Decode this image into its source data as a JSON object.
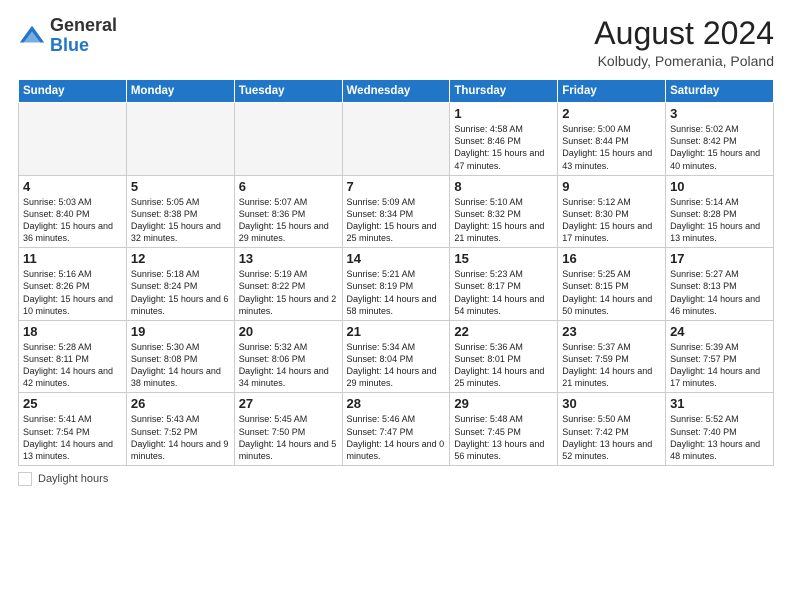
{
  "header": {
    "logo_general": "General",
    "logo_blue": "Blue",
    "month_year": "August 2024",
    "location": "Kolbudy, Pomerania, Poland"
  },
  "days_of_week": [
    "Sunday",
    "Monday",
    "Tuesday",
    "Wednesday",
    "Thursday",
    "Friday",
    "Saturday"
  ],
  "weeks": [
    [
      {
        "num": "",
        "content": ""
      },
      {
        "num": "",
        "content": ""
      },
      {
        "num": "",
        "content": ""
      },
      {
        "num": "",
        "content": ""
      },
      {
        "num": "1",
        "content": "Sunrise: 4:58 AM\nSunset: 8:46 PM\nDaylight: 15 hours\nand 47 minutes."
      },
      {
        "num": "2",
        "content": "Sunrise: 5:00 AM\nSunset: 8:44 PM\nDaylight: 15 hours\nand 43 minutes."
      },
      {
        "num": "3",
        "content": "Sunrise: 5:02 AM\nSunset: 8:42 PM\nDaylight: 15 hours\nand 40 minutes."
      }
    ],
    [
      {
        "num": "4",
        "content": "Sunrise: 5:03 AM\nSunset: 8:40 PM\nDaylight: 15 hours\nand 36 minutes."
      },
      {
        "num": "5",
        "content": "Sunrise: 5:05 AM\nSunset: 8:38 PM\nDaylight: 15 hours\nand 32 minutes."
      },
      {
        "num": "6",
        "content": "Sunrise: 5:07 AM\nSunset: 8:36 PM\nDaylight: 15 hours\nand 29 minutes."
      },
      {
        "num": "7",
        "content": "Sunrise: 5:09 AM\nSunset: 8:34 PM\nDaylight: 15 hours\nand 25 minutes."
      },
      {
        "num": "8",
        "content": "Sunrise: 5:10 AM\nSunset: 8:32 PM\nDaylight: 15 hours\nand 21 minutes."
      },
      {
        "num": "9",
        "content": "Sunrise: 5:12 AM\nSunset: 8:30 PM\nDaylight: 15 hours\nand 17 minutes."
      },
      {
        "num": "10",
        "content": "Sunrise: 5:14 AM\nSunset: 8:28 PM\nDaylight: 15 hours\nand 13 minutes."
      }
    ],
    [
      {
        "num": "11",
        "content": "Sunrise: 5:16 AM\nSunset: 8:26 PM\nDaylight: 15 hours\nand 10 minutes."
      },
      {
        "num": "12",
        "content": "Sunrise: 5:18 AM\nSunset: 8:24 PM\nDaylight: 15 hours\nand 6 minutes."
      },
      {
        "num": "13",
        "content": "Sunrise: 5:19 AM\nSunset: 8:22 PM\nDaylight: 15 hours\nand 2 minutes."
      },
      {
        "num": "14",
        "content": "Sunrise: 5:21 AM\nSunset: 8:19 PM\nDaylight: 14 hours\nand 58 minutes."
      },
      {
        "num": "15",
        "content": "Sunrise: 5:23 AM\nSunset: 8:17 PM\nDaylight: 14 hours\nand 54 minutes."
      },
      {
        "num": "16",
        "content": "Sunrise: 5:25 AM\nSunset: 8:15 PM\nDaylight: 14 hours\nand 50 minutes."
      },
      {
        "num": "17",
        "content": "Sunrise: 5:27 AM\nSunset: 8:13 PM\nDaylight: 14 hours\nand 46 minutes."
      }
    ],
    [
      {
        "num": "18",
        "content": "Sunrise: 5:28 AM\nSunset: 8:11 PM\nDaylight: 14 hours\nand 42 minutes."
      },
      {
        "num": "19",
        "content": "Sunrise: 5:30 AM\nSunset: 8:08 PM\nDaylight: 14 hours\nand 38 minutes."
      },
      {
        "num": "20",
        "content": "Sunrise: 5:32 AM\nSunset: 8:06 PM\nDaylight: 14 hours\nand 34 minutes."
      },
      {
        "num": "21",
        "content": "Sunrise: 5:34 AM\nSunset: 8:04 PM\nDaylight: 14 hours\nand 29 minutes."
      },
      {
        "num": "22",
        "content": "Sunrise: 5:36 AM\nSunset: 8:01 PM\nDaylight: 14 hours\nand 25 minutes."
      },
      {
        "num": "23",
        "content": "Sunrise: 5:37 AM\nSunset: 7:59 PM\nDaylight: 14 hours\nand 21 minutes."
      },
      {
        "num": "24",
        "content": "Sunrise: 5:39 AM\nSunset: 7:57 PM\nDaylight: 14 hours\nand 17 minutes."
      }
    ],
    [
      {
        "num": "25",
        "content": "Sunrise: 5:41 AM\nSunset: 7:54 PM\nDaylight: 14 hours\nand 13 minutes."
      },
      {
        "num": "26",
        "content": "Sunrise: 5:43 AM\nSunset: 7:52 PM\nDaylight: 14 hours\nand 9 minutes."
      },
      {
        "num": "27",
        "content": "Sunrise: 5:45 AM\nSunset: 7:50 PM\nDaylight: 14 hours\nand 5 minutes."
      },
      {
        "num": "28",
        "content": "Sunrise: 5:46 AM\nSunset: 7:47 PM\nDaylight: 14 hours\nand 0 minutes."
      },
      {
        "num": "29",
        "content": "Sunrise: 5:48 AM\nSunset: 7:45 PM\nDaylight: 13 hours\nand 56 minutes."
      },
      {
        "num": "30",
        "content": "Sunrise: 5:50 AM\nSunset: 7:42 PM\nDaylight: 13 hours\nand 52 minutes."
      },
      {
        "num": "31",
        "content": "Sunrise: 5:52 AM\nSunset: 7:40 PM\nDaylight: 13 hours\nand 48 minutes."
      }
    ]
  ],
  "footer": {
    "label": "Daylight hours"
  }
}
